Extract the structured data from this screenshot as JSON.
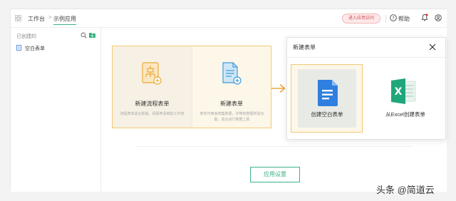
{
  "header": {
    "breadcrumb": [
      "工作台",
      "示例应用"
    ],
    "breadcrumb_separator": ">",
    "visit_button": "进入应用访问",
    "help_label": "帮助",
    "icons": [
      "grid-icon",
      "help-icon",
      "bell-icon",
      "user-icon"
    ]
  },
  "sidebar": {
    "title": "已创建的",
    "items": [
      {
        "label": "空白表单",
        "icon": "form-icon"
      }
    ]
  },
  "main": {
    "cards": [
      {
        "title": "新建流程表单",
        "description": "流程表单适合报销、请假申请审批工作流",
        "icon": "flow-form-icon"
      },
      {
        "title": "新建表单",
        "description": "表单可用来搜集数据，并带有数据校验功能，适合进行数据上报",
        "icon": "form-add-icon"
      }
    ],
    "settings_button": "应用设置"
  },
  "dialog": {
    "title": "新建表单",
    "options": [
      {
        "label": "创建空白表单",
        "icon": "blank-doc-icon"
      },
      {
        "label": "从Excel创建表单",
        "icon": "excel-icon"
      }
    ]
  },
  "watermark": "头条 @简道云",
  "colors": {
    "accent_green": "#3db384",
    "highlight_border": "#f2c871",
    "highlight_bg": "#fdf7ea",
    "doc_blue": "#2f7fe0",
    "excel_green": "#1fa67a"
  }
}
